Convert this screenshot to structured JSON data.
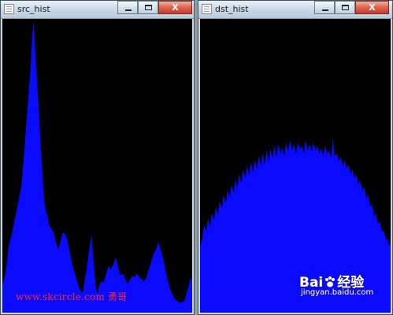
{
  "windows": [
    {
      "title": "src_hist",
      "controls": {
        "close_label": "X"
      }
    },
    {
      "title": "dst_hist",
      "controls": {
        "close_label": "X"
      }
    }
  ],
  "watermark": {
    "text": "www.skcircle.com 勇哥"
  },
  "baidu": {
    "line1_left": "Bai",
    "line1_right": "经验",
    "line2": "jingyan.baidu.com"
  },
  "colors": {
    "histogram_fill": "#0a0aff",
    "canvas_bg": "#000000",
    "watermark": "#ff2a2a"
  }
}
